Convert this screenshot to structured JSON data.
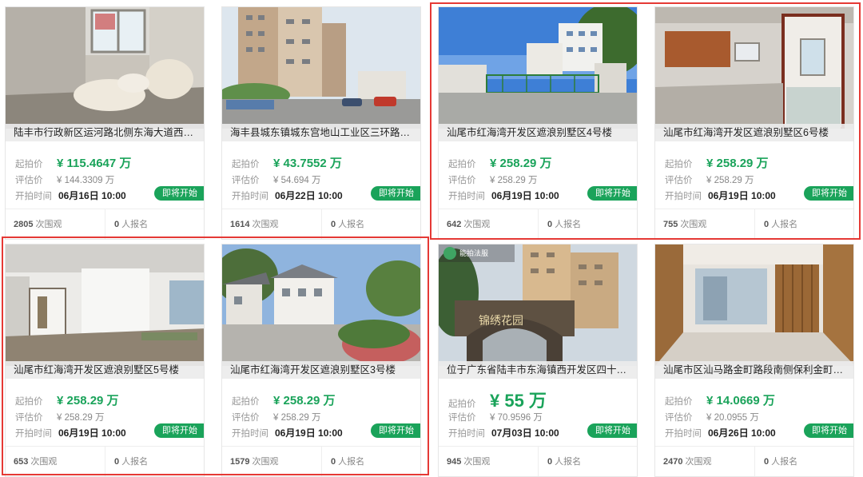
{
  "labels": {
    "start_price": "起拍价",
    "estimate": "评估价",
    "start_time": "开拍时间",
    "badge": "即将开始",
    "views_suffix": "次围观",
    "signup_suffix": "人报名"
  },
  "colors": {
    "accent": "#1aa35a",
    "highlight": "#e53935"
  },
  "cards": [
    {
      "title": "陆丰市行政新区运河路北侧东海大道西…",
      "price": "¥ 115.4647 万",
      "estimate": "¥ 144.3309 万",
      "time": "06月16日 10:00",
      "views": "2805",
      "signups": "0"
    },
    {
      "title": "海丰县城东镇城东宫地山工业区三环路…",
      "price": "¥ 43.7552 万",
      "estimate": "¥ 54.694 万",
      "time": "06月22日 10:00",
      "views": "1614",
      "signups": "0"
    },
    {
      "title": "汕尾市红海湾开发区遮浪别墅区4号楼",
      "price": "¥ 258.29 万",
      "estimate": "¥ 258.29 万",
      "time": "06月19日 10:00",
      "views": "642",
      "signups": "0"
    },
    {
      "title": "汕尾市红海湾开发区遮浪别墅区6号楼",
      "price": "¥ 258.29 万",
      "estimate": "¥ 258.29 万",
      "time": "06月19日 10:00",
      "views": "755",
      "signups": "0"
    },
    {
      "title": "汕尾市红海湾开发区遮浪别墅区5号楼",
      "price": "¥ 258.29 万",
      "estimate": "¥ 258.29 万",
      "time": "06月19日 10:00",
      "views": "653",
      "signups": "0"
    },
    {
      "title": "汕尾市红海湾开发区遮浪别墅区3号楼",
      "price": "¥ 258.29 万",
      "estimate": "¥ 258.29 万",
      "time": "06月19日 10:00",
      "views": "1579",
      "signups": "0"
    },
    {
      "title": "位于广东省陆丰市东海镇西开发区四十…",
      "price": "¥ 55 万",
      "estimate": "¥ 70.9596 万",
      "time": "07月03日 10:00",
      "views": "945",
      "signups": "0",
      "watermark": "能拍法服",
      "sign_text": "锦绣花园"
    },
    {
      "title": "汕尾市区汕马路金町路段南侧保利金町…",
      "price": "¥ 14.0669 万",
      "estimate": "¥ 20.0955 万",
      "time": "06月26日 10:00",
      "views": "2470",
      "signups": "0"
    }
  ]
}
